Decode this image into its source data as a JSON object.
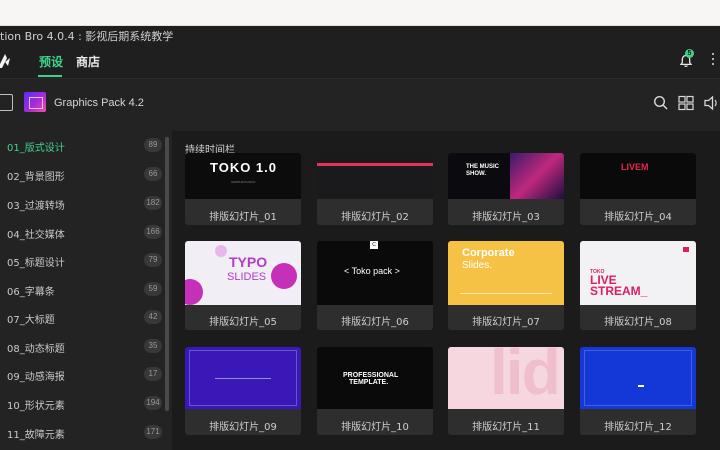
{
  "window": {
    "title": "tion Bro 4.0.4 : 影视后期系统教学"
  },
  "nav": {
    "tabs": [
      {
        "label": "预设",
        "active": true
      },
      {
        "label": "商店",
        "active": false
      }
    ],
    "notification_count": "5",
    "accent": "#3fd38a"
  },
  "pack": {
    "title": "Graphics Pack 4.2"
  },
  "sidebar": {
    "items": [
      {
        "label": "01_版式设计",
        "count": "89",
        "active": true
      },
      {
        "label": "02_背景图形",
        "count": "66"
      },
      {
        "label": "03_过渡转场",
        "count": "182"
      },
      {
        "label": "04_社交媒体",
        "count": "166"
      },
      {
        "label": "05_标题设计",
        "count": "79"
      },
      {
        "label": "06_字幕条",
        "count": "59"
      },
      {
        "label": "07_大标题",
        "count": "42"
      },
      {
        "label": "08_动态标题",
        "count": "35"
      },
      {
        "label": "09_动感海报",
        "count": "17"
      },
      {
        "label": "10_形状元素",
        "count": "194"
      },
      {
        "label": "11_故障元素",
        "count": "171"
      }
    ]
  },
  "main": {
    "section_title": "持续时间栏",
    "cards": [
      {
        "caption": "排版幻灯片_01",
        "thumb_text": "TOKO 1.0",
        "thumb_sub": "GRAPHICS PACK"
      },
      {
        "caption": "排版幻灯片_02"
      },
      {
        "caption": "排版幻灯片_03",
        "thumb_text": "THE MUSIC SHOW."
      },
      {
        "caption": "排版幻灯片_04",
        "thumb_text": "LIVEM"
      },
      {
        "caption": "排版幻灯片_05",
        "thumb_text": "TYPO",
        "thumb_sub": "SLIDES"
      },
      {
        "caption": "排版幻灯片_06",
        "thumb_text": "< Toko pack >",
        "thumb_sub": "C"
      },
      {
        "caption": "排版幻灯片_07",
        "thumb_text": "Corporate",
        "thumb_sub": "Slides."
      },
      {
        "caption": "排版幻灯片_08",
        "thumb_text": "LIVE",
        "thumb_sub": "STREAM_",
        "thumb_top": "TOKO"
      },
      {
        "caption": "排版幻灯片_09"
      },
      {
        "caption": "排版幻灯片_10",
        "thumb_text": "PROFESSIONAL",
        "thumb_sub": "TEMPLATE."
      },
      {
        "caption": "排版幻灯片_11",
        "thumb_text": "lid"
      },
      {
        "caption": "排版幻灯片_12"
      }
    ]
  }
}
